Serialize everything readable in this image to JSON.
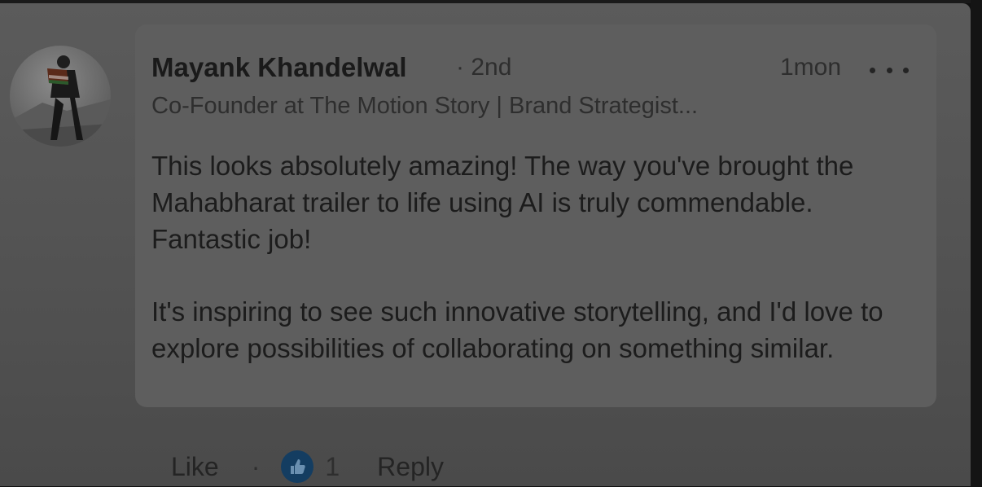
{
  "comment": {
    "author_name": "Mayank Khandelwal",
    "degree": "· 2nd",
    "time": "1mon",
    "headline": "Co-Founder at The Motion Story | Brand Strategist...",
    "paragraphs": [
      "This looks absolutely amazing! The way you've brought the Mahabharat trailer to life using AI is truly commendable. Fantastic job!",
      "It's inspiring to see such innovative storytelling, and I'd love to explore possibilities of collaborating on something similar."
    ],
    "avatar_icon": "profile-photo"
  },
  "actions": {
    "like_label": "Like",
    "separator": "·",
    "reaction_icon": "like-reaction-icon",
    "reaction_count": "1",
    "reply_label": "Reply"
  },
  "colors": {
    "reaction_blue": "#143d61",
    "bubble": "#5e5e5e",
    "background": "#545454"
  }
}
